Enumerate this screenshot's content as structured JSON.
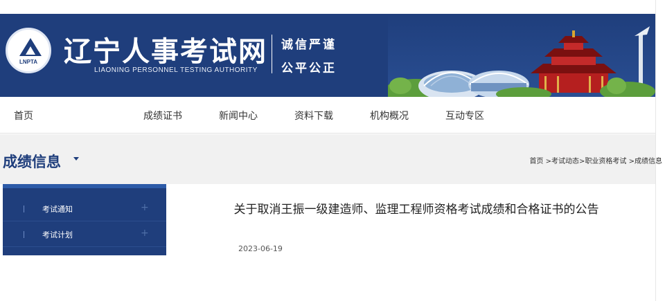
{
  "header": {
    "logo_abbr": "LNPTA",
    "site_title": "辽宁人事考试网",
    "site_subtitle": "LIAONING PERSONNEL TESTING AUTHORITY",
    "motto_line1": "诚信严谨",
    "motto_line2": "公平公正",
    "brand_color": "#1f3e7c"
  },
  "nav": {
    "items": [
      {
        "label": "首页"
      },
      {
        "label": "成绩证书"
      },
      {
        "label": "新闻中心"
      },
      {
        "label": "资料下载"
      },
      {
        "label": "机构概况"
      },
      {
        "label": "互动专区"
      }
    ]
  },
  "section": {
    "title": "成绩信息",
    "breadcrumb": [
      "首页",
      " >",
      "考试动态",
      ">",
      "职业资格考试",
      " >",
      "成绩信息"
    ]
  },
  "sidebar": {
    "items": [
      {
        "label": "考试通知",
        "toggle": "+"
      },
      {
        "label": "考试计划",
        "toggle": "+"
      }
    ]
  },
  "article": {
    "title": "关于取消王振一级建造师、监理工程师资格考试成绩和合格证书的公告",
    "date": "2023-06-19"
  }
}
